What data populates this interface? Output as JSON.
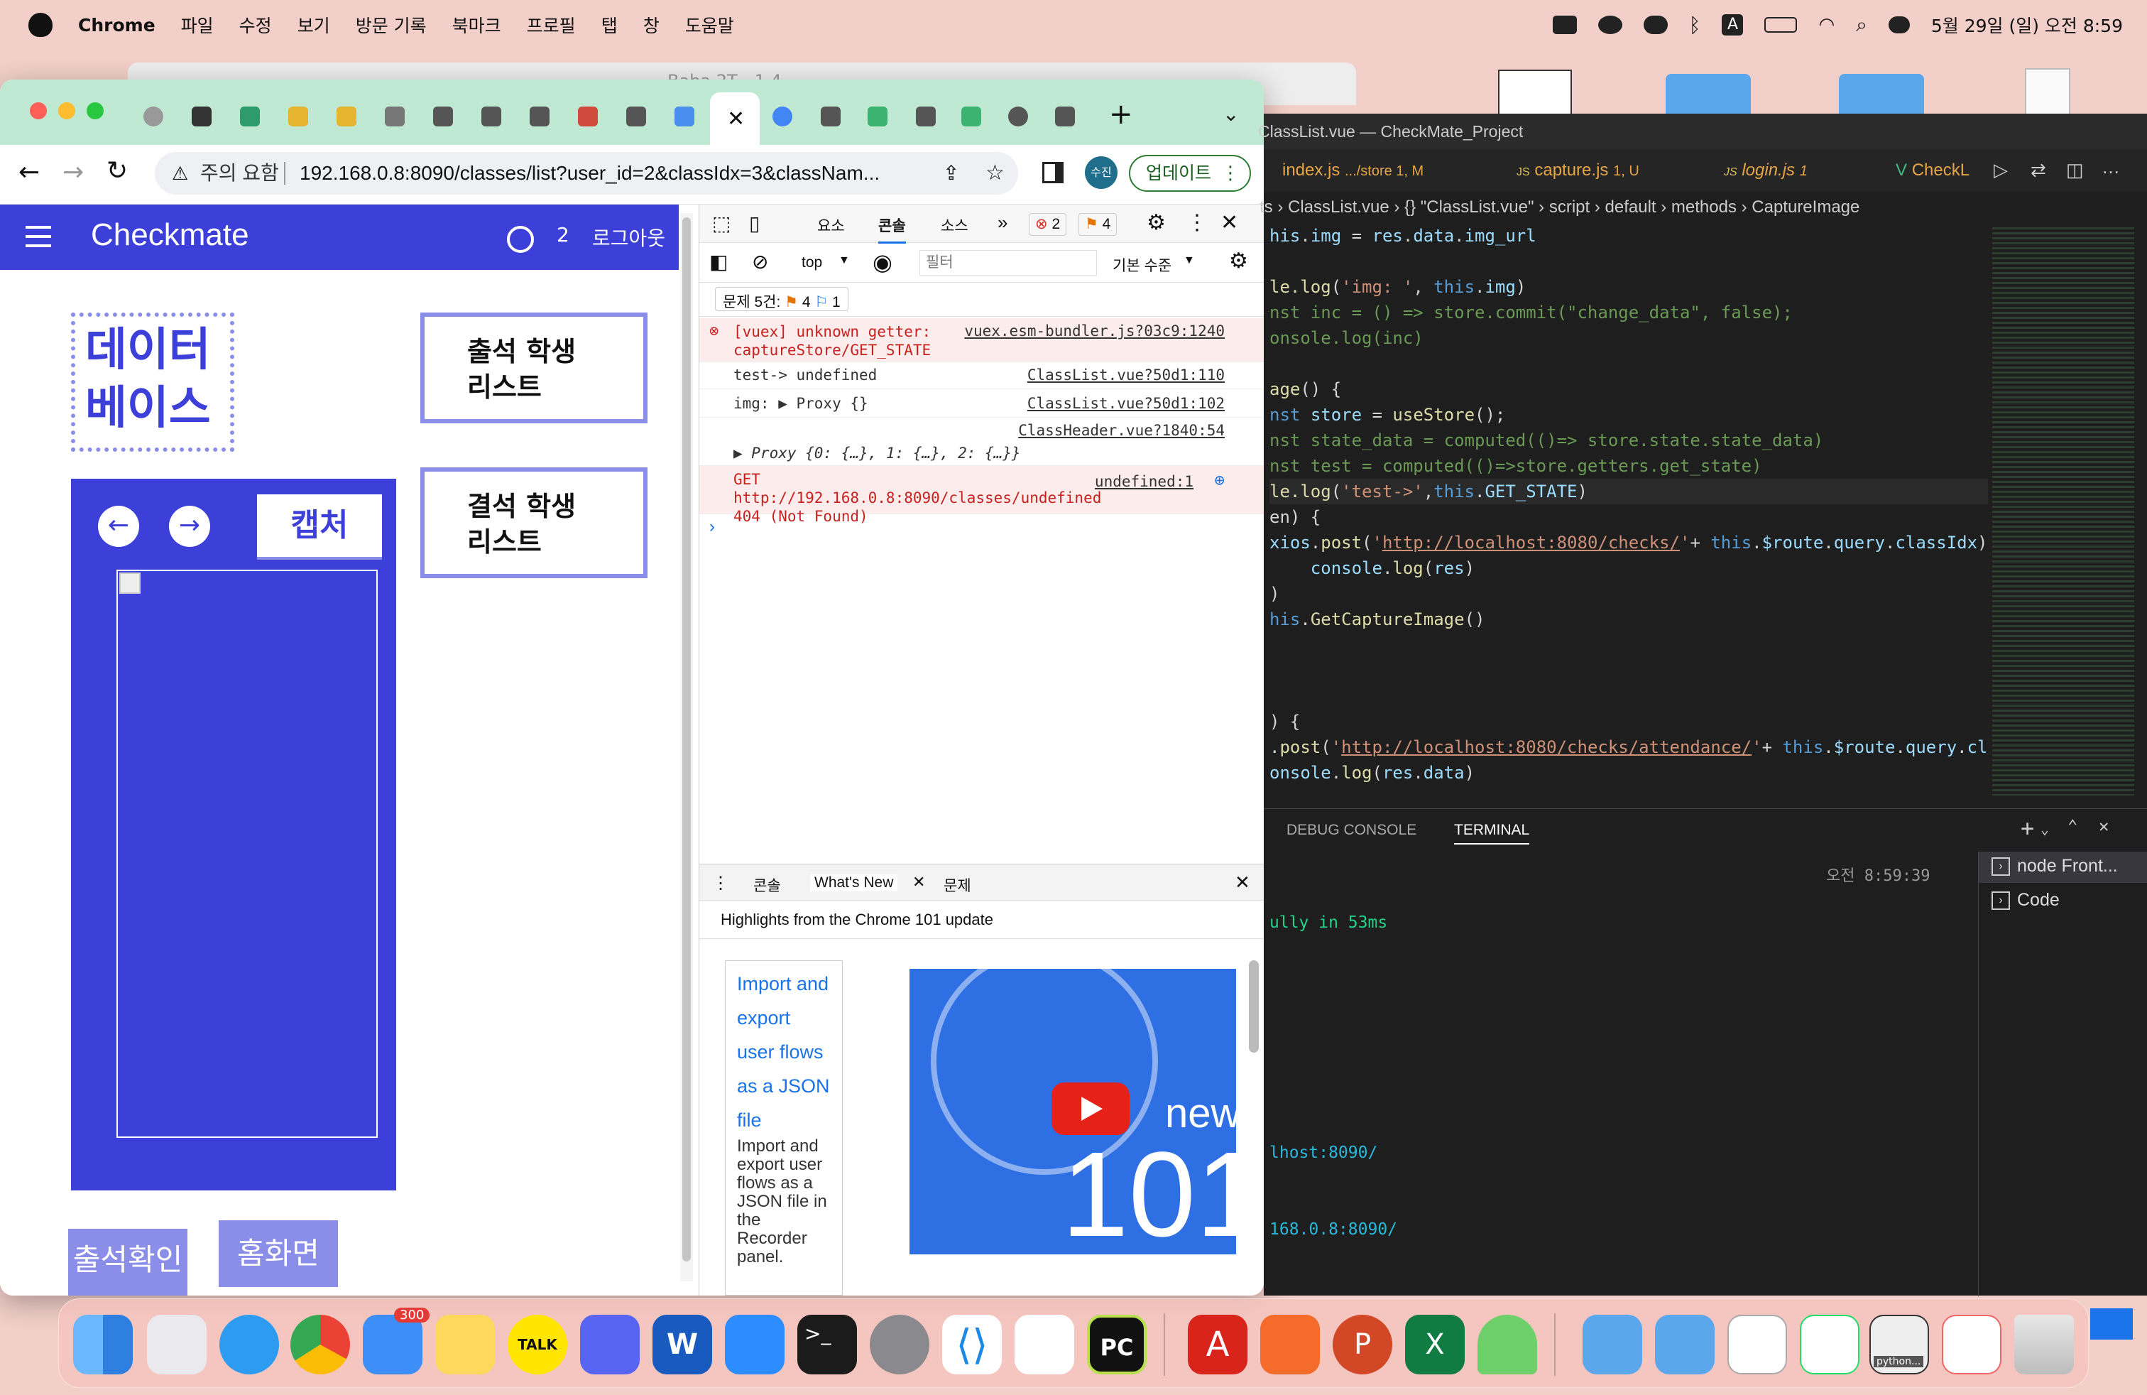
{
  "menubar": {
    "app": "Chrome",
    "items": [
      "파일",
      "수정",
      "보기",
      "방문 기록",
      "북마크",
      "프로필",
      "탭",
      "창",
      "도움말"
    ],
    "datetime": "5월 29일 (일) 오전 8:59"
  },
  "behind_window_title": "Baba 2T - 1.4",
  "chrome": {
    "address_warning": "주의 요함",
    "url": "192.168.0.8:8090/classes/list?user_id=2&classIdx=3&classNam...",
    "profile": "수진",
    "update_label": "업데이트"
  },
  "checkmate": {
    "brand": "Checkmate",
    "user_count": "2",
    "logout": "로그아웃",
    "class_title": "데이터 베이스",
    "capture_button": "캡처",
    "attend_list_button": "출석 학생 리스트",
    "absent_list_button": "결석 학생 리스트",
    "attendance_check_button": "출석확인",
    "home_button": "홈화면"
  },
  "devtools": {
    "tabs": [
      "요소",
      "콘솔",
      "소스"
    ],
    "active_tab": "콘솔",
    "error_count": "2",
    "warning_count": "4",
    "context": "top",
    "filter_placeholder": "필터",
    "level": "기본 수준",
    "issues_label": "문제 5건:",
    "issues_warn": "4",
    "issues_info": "1",
    "logs": [
      {
        "type": "error",
        "text": "[vuex] unknown getter: captureStore/GET_STATE",
        "source": "vuex.esm-bundler.js?03c9:1240"
      },
      {
        "type": "log",
        "text": "test-> undefined",
        "source": "ClassList.vue?50d1:110"
      },
      {
        "type": "log",
        "text": "img:  ▶ Proxy {}",
        "source": "ClassList.vue?50d1:102"
      },
      {
        "type": "log",
        "text": "▶ Proxy {0: {…}, 1: {…}, 2: {…}}",
        "source": "ClassHeader.vue?1840:54"
      },
      {
        "type": "error",
        "text": "GET http://192.168.0.8:8090/classes/undefined 404 (Not Found)",
        "source": "undefined:1"
      }
    ],
    "drawer_tabs": [
      "콘솔",
      "What's New",
      "문제"
    ],
    "drawer_active": "What's New",
    "whatsnew_heading": "Highlights from the Chrome 101 update",
    "whatsnew_link": "Import and export user flows as a JSON file",
    "whatsnew_desc": "Import and export user flows as a JSON file in the Recorder panel.",
    "video_new": "new",
    "video_number": "101"
  },
  "vscode": {
    "title": "ClassList.vue — CheckMate_Project",
    "tabs": [
      {
        "label": "index.js",
        "detail": ".../store 1, M"
      },
      {
        "label": "capture.js",
        "detail": "1, U"
      },
      {
        "label": "login.js",
        "detail": "1"
      },
      {
        "label": "CheckL",
        "detail": ""
      }
    ],
    "breadcrumb": "ts › ClassList.vue › {} \"ClassList.vue\" › script › default › methods › CaptureImage",
    "panel_tabs": [
      "DEBUG CONSOLE",
      "TERMINAL"
    ],
    "panel_active": "TERMINAL",
    "terminal_lines": [
      "ully in 53ms",
      "",
      "",
      "lhost:8090/",
      "168.0.8:8090/"
    ],
    "terminal_time": "오전  8:59:39",
    "terminal_list": [
      "node  Front...",
      "Code"
    ]
  },
  "dock": {
    "mail_badge": "300",
    "python_label": "python..."
  },
  "colors": {
    "brand": "#3c3fd8",
    "button_border": "#8b8ee8",
    "devtools_error_bg": "#fdecec",
    "vscode_bg": "#1e1e1e"
  }
}
